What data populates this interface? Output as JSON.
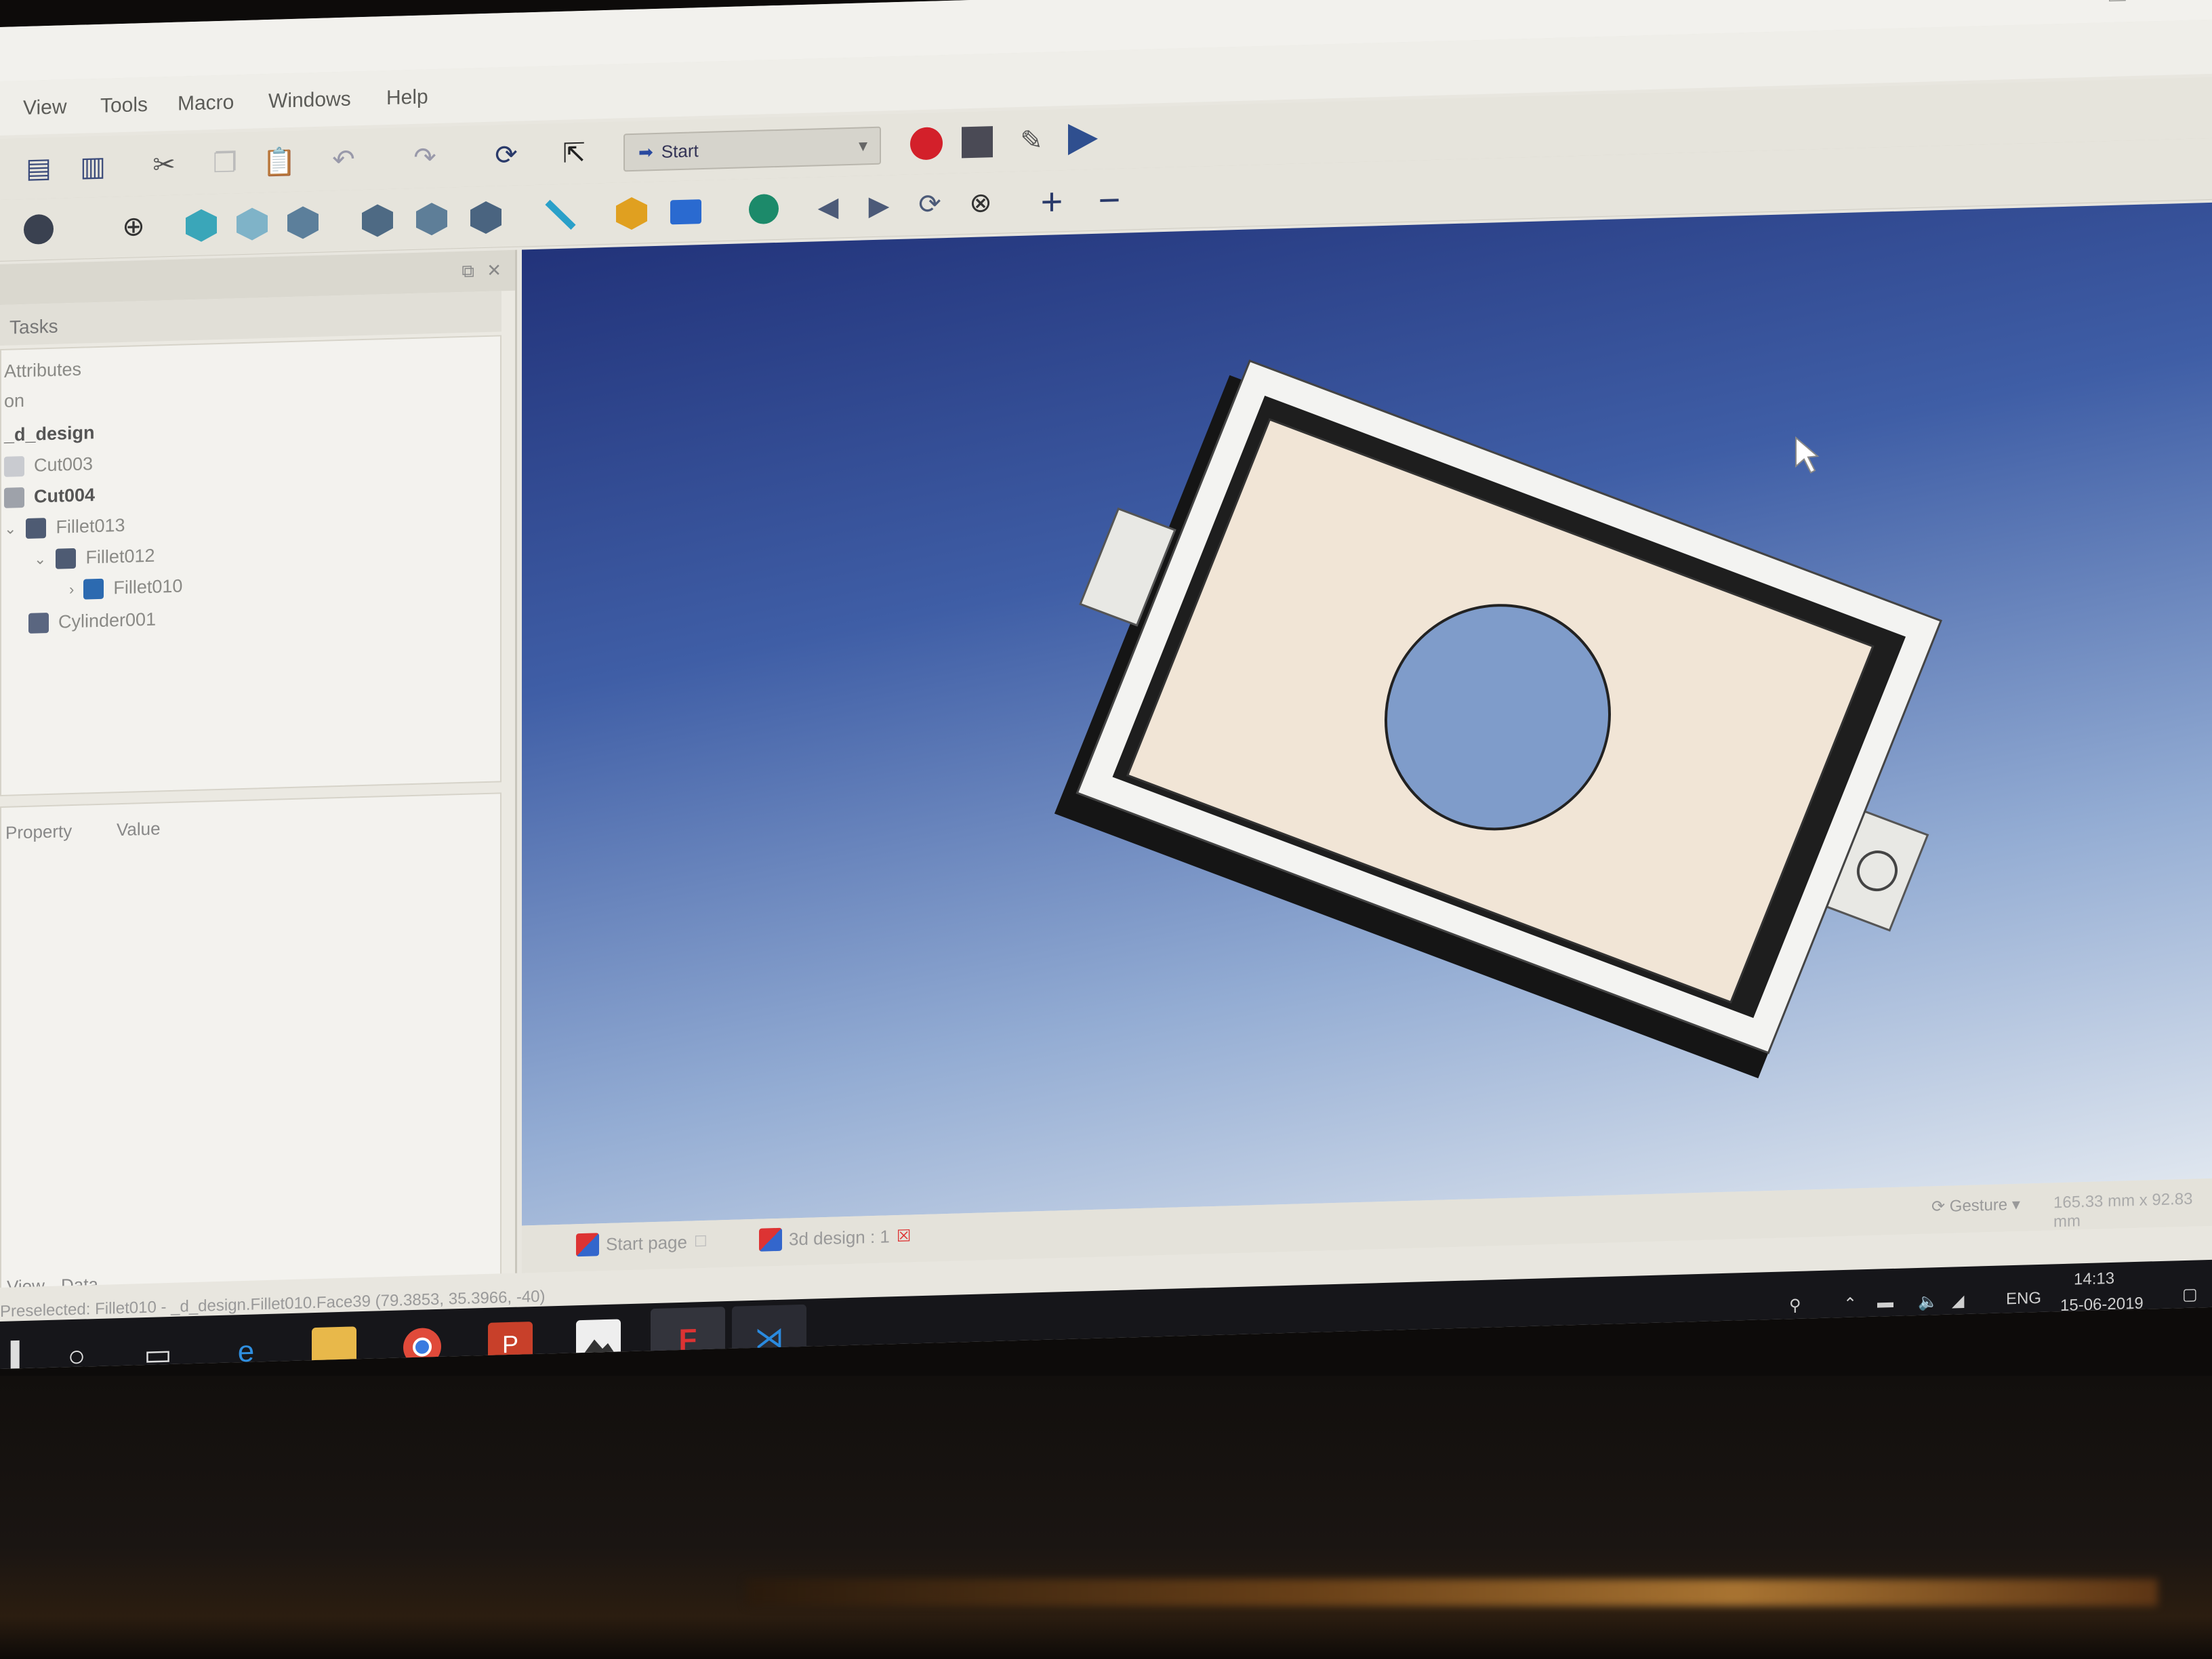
{
  "window": {
    "controls": [
      "—",
      "❐",
      "✕"
    ]
  },
  "menu": {
    "items": [
      "View",
      "Tools",
      "Macro",
      "Windows",
      "Help"
    ]
  },
  "toolbar": {
    "workbench": "Start",
    "icons_row1": [
      "save-icon",
      "save-as-icon",
      "cut-icon",
      "copy-icon",
      "paste-icon",
      "undo-icon",
      "redo-icon",
      "refresh-icon",
      "whats-this-icon"
    ],
    "icons_row2": [
      "view-style-icon",
      "fit-all-icon",
      "isometric-view-icon",
      "front-view-icon",
      "top-view-icon",
      "right-view-icon",
      "rear-view-icon",
      "bottom-view-icon",
      "left-view-icon",
      "measure-icon",
      "part-icon",
      "group-icon",
      "web-icon",
      "back-icon",
      "forward-icon",
      "reload-icon",
      "stop-icon",
      "zoom-in-icon",
      "zoom-out-icon"
    ],
    "macro_icons": [
      "record-macro-icon",
      "stop-macro-icon",
      "edit-macro-icon",
      "run-macro-icon"
    ],
    "colors": {
      "record": "#d3202a",
      "stop": "#4a4a55",
      "run": "#2f4f8f"
    }
  },
  "combo": {
    "tab": "Tasks",
    "tree_header": "Attributes",
    "tree_sub": "on",
    "tree": [
      {
        "label": "_d_design",
        "bold": true,
        "indent": 0
      },
      {
        "label": "Cut003",
        "indent": 1
      },
      {
        "label": "Cut004",
        "bold": true,
        "indent": 1
      },
      {
        "label": "Fillet013",
        "indent": 1
      },
      {
        "label": "Fillet012",
        "indent": 2
      },
      {
        "label": "Fillet010",
        "indent": 3
      },
      {
        "label": "Cylinder001",
        "indent": 1
      }
    ],
    "props_columns": [
      "Property",
      "Value"
    ],
    "bottom_tabs": [
      "View",
      "Data"
    ]
  },
  "doc_tabs": [
    {
      "label": "Start page"
    },
    {
      "label": "3d design : 1"
    }
  ],
  "status": {
    "preselected": "Preselected: Fillet010 - _d_design.Fillet010.Face39 (79.3853, 35.3966, -40)",
    "nav_mode": "Gesture",
    "dimensions": "165.33 mm x 92.83 mm"
  },
  "taskbar": {
    "apps": [
      "start-icon",
      "search-icon",
      "task-view-icon",
      "edge-icon",
      "file-explorer-icon",
      "chrome-icon",
      "powerpoint-icon",
      "photos-icon",
      "freecad-icon",
      "vscode-icon"
    ],
    "tray_lang": "ENG",
    "time": "14:13",
    "date": "15-06-2019"
  }
}
